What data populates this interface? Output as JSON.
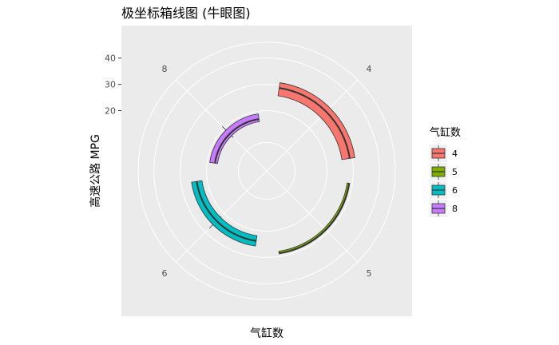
{
  "chart_data": {
    "type": "boxplot",
    "coord": "polar",
    "title": "极坐标箱线图 (牛眼图)",
    "xlabel": "气缸数",
    "ylabel": "高速公路 MPG",
    "categories": [
      "4",
      "5",
      "6",
      "8"
    ],
    "yticks": [
      20,
      30,
      40
    ],
    "ylim": [
      8,
      46
    ],
    "boxes": [
      {
        "category": "4",
        "color": "#F8766D",
        "lower_whisker": 26,
        "q1": 26,
        "median": 29,
        "q3": 31,
        "upper_whisker": 31
      },
      {
        "category": "5",
        "color": "#7CAE00",
        "lower_whisker": 28,
        "q1": 28,
        "median": 28.8,
        "q3": 29,
        "upper_whisker": 29
      },
      {
        "category": "6",
        "color": "#00BFC4",
        "lower_whisker": 21.5,
        "q1": 22,
        "median": 24,
        "q3": 26,
        "upper_whisker": 28
      },
      {
        "category": "8",
        "color": "#C77CFF",
        "lower_whisker": 15,
        "q1": 16,
        "median": 17,
        "q3": 19,
        "upper_whisker": 21
      }
    ],
    "grid": true,
    "legend": {
      "title": "气缸数",
      "position": "right",
      "entries": [
        "4",
        "5",
        "6",
        "8"
      ]
    }
  }
}
